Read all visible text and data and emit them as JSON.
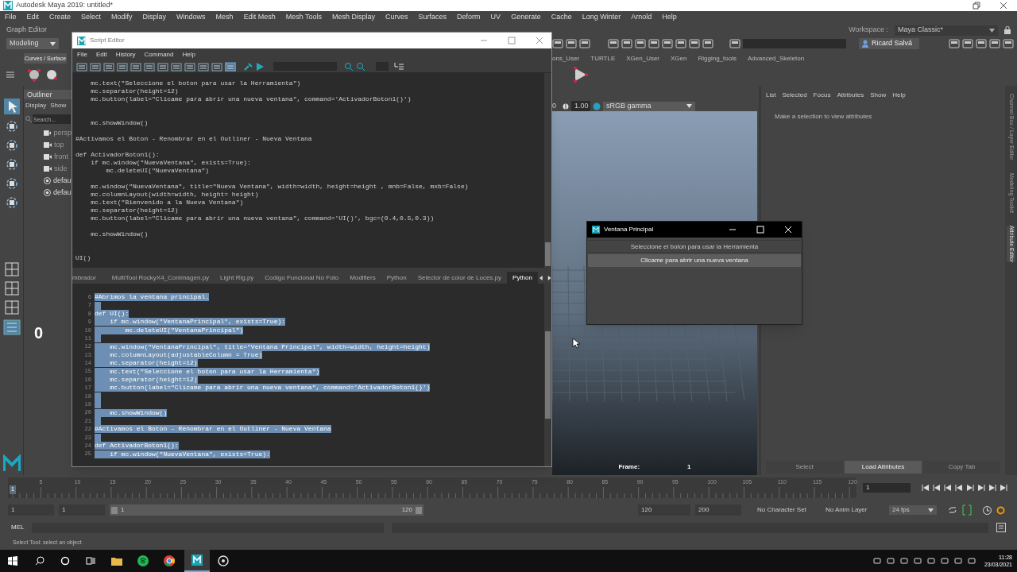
{
  "window": {
    "title": "Autodesk Maya 2019: untitled*"
  },
  "menu_bar": [
    "File",
    "Edit",
    "Create",
    "Select",
    "Modify",
    "Display",
    "Windows",
    "Mesh",
    "Edit Mesh",
    "Mesh Tools",
    "Mesh Display",
    "Curves",
    "Surfaces",
    "Deform",
    "UV",
    "Generate",
    "Cache",
    "Long Winter",
    "Arnold",
    "Help"
  ],
  "graph_editor_label": "Graph Editor",
  "workspace": {
    "label": "Workspace :",
    "value": "Maya Classic*"
  },
  "menu_set": "Modeling",
  "user": "Ricard Salvá",
  "shelf_tabs": [
    {
      "label": "Curves / Surface",
      "selected": true
    },
    {
      "label": "ons_User",
      "selected": false
    },
    {
      "label": "TURTLE",
      "selected": false
    },
    {
      "label": "XGen_User",
      "selected": false
    },
    {
      "label": "XGen",
      "selected": false
    },
    {
      "label": "Rigging_tools",
      "selected": false
    },
    {
      "label": "Advanced_Skeleton",
      "selected": false
    }
  ],
  "outliner": {
    "title": "Outliner",
    "menus": [
      "Display",
      "Show"
    ],
    "search_placeholder": "Search...",
    "items": [
      {
        "label": "persp",
        "kind": "camera"
      },
      {
        "label": "top",
        "kind": "camera"
      },
      {
        "label": "front",
        "kind": "camera"
      },
      {
        "label": "side",
        "kind": "camera"
      },
      {
        "label": "defau",
        "kind": "set"
      },
      {
        "label": "defau",
        "kind": "set"
      }
    ]
  },
  "counter": "0",
  "viewport": {
    "exposure": "0",
    "gamma": "1.00",
    "color_space": "sRGB gamma",
    "frame_label": "Frame:",
    "frame": "1"
  },
  "attribute_editor": {
    "menus": [
      "List",
      "Selected",
      "Focus",
      "Attributes",
      "Show",
      "Help"
    ],
    "message": "Make a selection to view attributes",
    "buttons": [
      {
        "label": "Select",
        "disabled": true
      },
      {
        "label": "Load Attributes",
        "disabled": false
      },
      {
        "label": "Copy Tab",
        "disabled": true
      }
    ]
  },
  "side_tabs": [
    {
      "label": "Channel Box / Layer Editor",
      "selected": false
    },
    {
      "label": "Modeling Toolkit",
      "selected": false
    },
    {
      "label": "Attribute Editor",
      "selected": true
    }
  ],
  "script_editor": {
    "title": "Script Editor",
    "menus": [
      "File",
      "Edit",
      "History",
      "Command",
      "Help"
    ],
    "history": "    mc.text(\"Seleccione el boton para usar la Herramienta\")\n    mc.separator(height=12)\n    mc.button(label=\"Clicame para abrir una nueva ventana\", command='ActivadorBoton1()')\n\n\n    mc.showWindow()\n\n#Activamos el Boton - Renombrar en el Outliner - Nueva Ventana\n\ndef ActivadorBoton1():\n    if mc.window(\"NuevaVentana\", exists=True):\n        mc.deleteUI(\"NuevaVentana\")\n\n    mc.window(\"NuevaVentana\", title=\"Nueva Ventana\", width=width, height=height , mnb=False, mxb=False)\n    mc.columnLayout(width=width, height= height)\n    mc.text(\"Bienvenido a la Nueva Ventana\")\n    mc.separator(height=12)\n    mc.button(label=\"Clicame para abrir una nueva ventana\", command='UI()', bgc=(0.4,0.5,0.3))\n\n    mc.showWindow()\n\n\nUI()",
    "tabs": [
      {
        "label": "mbrador",
        "selected": false
      },
      {
        "label": "MultiTool RockyX4_ConImagen.py",
        "selected": false
      },
      {
        "label": "Light Rig.py",
        "selected": false
      },
      {
        "label": "Codigo Funcional No Foto",
        "selected": false
      },
      {
        "label": "Modifiers",
        "selected": false
      },
      {
        "label": "Python",
        "selected": false
      },
      {
        "label": "Selector de color de Luces.py",
        "selected": false
      },
      {
        "label": "Python",
        "selected": true
      }
    ],
    "lines": [
      {
        "number": "6",
        "code": "#Abrimos la ventana principal.",
        "selected": true
      },
      {
        "number": "7",
        "selected": true
      },
      {
        "number": "8",
        "code": "def UI():",
        "selected": true
      },
      {
        "number": "9",
        "code": "    if mc.window(\"VentanaPrincipal\", exists=True):",
        "selected": true
      },
      {
        "number": "10",
        "code": "        mc.deleteUI(\"VentanaPrincipal\")",
        "selected": true
      },
      {
        "number": "11",
        "selected": true
      },
      {
        "number": "12",
        "code": "    mc.window(\"VentanaPrincipal\", title=\"Ventana Principal\", width=width, height=height)",
        "selected": true
      },
      {
        "number": "13",
        "code": "    mc.columnLayout(adjustableColumn = True)",
        "selected": true
      },
      {
        "number": "14",
        "code": "    mc.separator(height=12)",
        "selected": true
      },
      {
        "number": "15",
        "code": "    mc.text(\"Seleccione el boton para usar la Herramienta\")",
        "selected": true
      },
      {
        "number": "16",
        "code": "    mc.separator(height=12)",
        "selected": true
      },
      {
        "number": "17",
        "code": "    mc.button(label=\"Clicame para abrir una nueva ventana\", command='ActivadorBoton1()')",
        "selected": true
      },
      {
        "number": "18",
        "selected": true
      },
      {
        "number": "19",
        "selected": true
      },
      {
        "number": "20",
        "code": "    mc.showWindow()",
        "selected": true
      },
      {
        "number": "21",
        "selected": true
      },
      {
        "number": "22",
        "code": "#Activamos el Boton - Renombrar en el Outliner - Nueva Ventana",
        "selected": true
      },
      {
        "number": "23",
        "selected": true
      },
      {
        "number": "24",
        "code": "def ActivadorBoton1():",
        "selected": true
      },
      {
        "number": "25",
        "code": "    if mc.window(\"NuevaVentana\", exists=True):",
        "selected": true
      }
    ]
  },
  "dialog": {
    "title": "Ventana Principal",
    "text": "Seleccione el boton para usar la Herramienta",
    "button": "Clicame para abrir una nueva ventana"
  },
  "timeline": {
    "start_label": "1",
    "ticks": [
      "5",
      "10",
      "15",
      "20",
      "25",
      "30",
      "35",
      "40",
      "45",
      "50",
      "55",
      "60",
      "65",
      "70",
      "75",
      "80",
      "85",
      "90",
      "95",
      "100",
      "105",
      "110",
      "115",
      "120"
    ],
    "current_frame": "1"
  },
  "range": {
    "level": 1,
    "start": "1",
    "playback_start": "1",
    "slider_start": "1",
    "slider_end": "120",
    "playback_end": "120",
    "end": "200",
    "character_set": "No Character Set",
    "anim_layer": "No Anim Layer",
    "fps": "24 fps"
  },
  "command_line": {
    "language": "MEL"
  },
  "help_line": "Select Tool: select an object",
  "taskbar": {
    "time": "11:28",
    "date": "23/03/2021"
  }
}
